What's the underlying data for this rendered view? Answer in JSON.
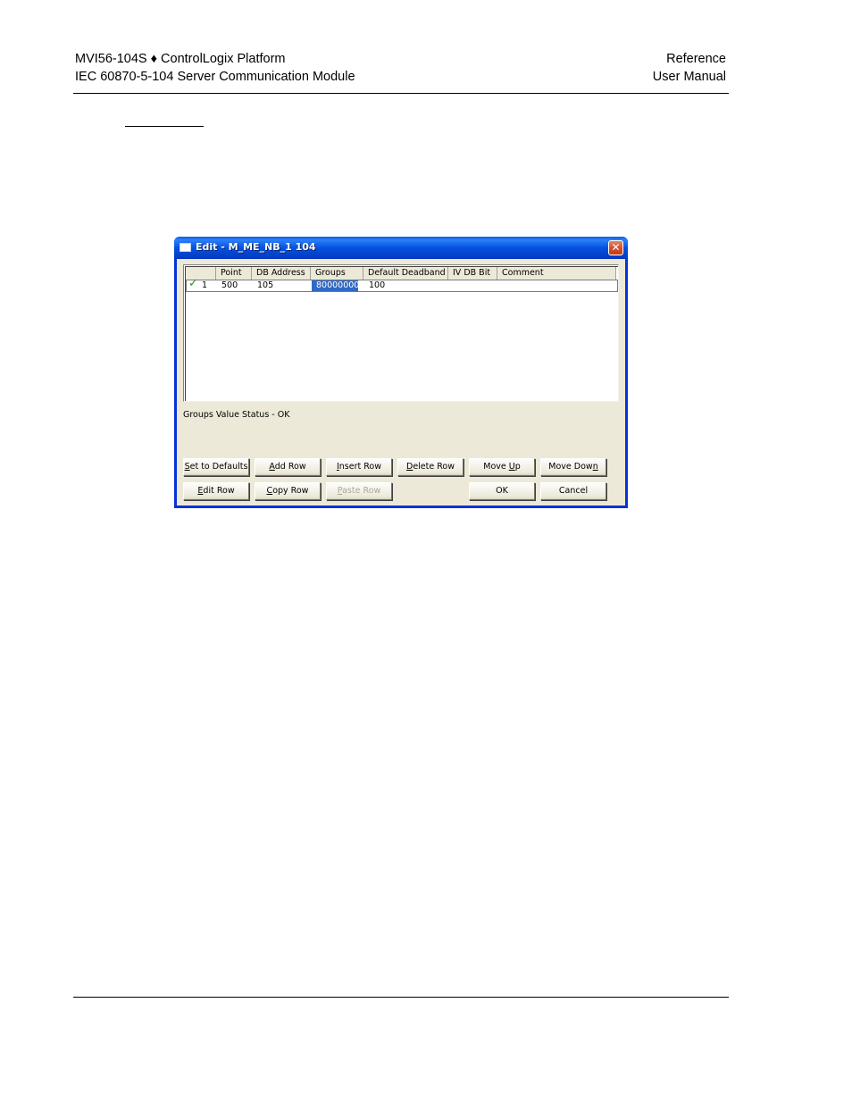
{
  "header": {
    "left_line1": "MVI56-104S ♦ ControlLogix Platform",
    "left_line2": "IEC 60870-5-104 Server Communication Module",
    "right_line1": "Reference",
    "right_line2": "User Manual"
  },
  "dialog": {
    "title": "Edit - M_ME_NB_1 104",
    "close_glyph": "✕",
    "columns": [
      "",
      "Point",
      "DB Address",
      "Groups",
      "Default Deadband",
      "IV DB Bit",
      "Comment"
    ],
    "rows": [
      {
        "status_icon": "check-icon",
        "status_glyph": "✓",
        "index": "1",
        "point": "500",
        "db_address": "105",
        "groups": "80000000",
        "default_deadband": "100",
        "iv_db_bit": "",
        "comment": ""
      }
    ],
    "selected_cell": "groups",
    "status_text": "Groups Value Status - OK",
    "buttons": {
      "set_to_defaults": {
        "pre": "",
        "u": "S",
        "post": "et to Defaults",
        "enabled": true
      },
      "add_row": {
        "pre": "",
        "u": "A",
        "post": "dd Row",
        "enabled": true
      },
      "insert_row": {
        "pre": "",
        "u": "I",
        "post": "nsert Row",
        "enabled": true
      },
      "delete_row": {
        "pre": "",
        "u": "D",
        "post": "elete Row",
        "enabled": true
      },
      "move_up": {
        "pre": "Move ",
        "u": "U",
        "post": "p",
        "enabled": true
      },
      "move_down": {
        "pre": "Move Dow",
        "u": "n",
        "post": "",
        "enabled": true
      },
      "edit_row": {
        "pre": "",
        "u": "E",
        "post": "dit Row",
        "enabled": true
      },
      "copy_row": {
        "pre": "",
        "u": "C",
        "post": "opy Row",
        "enabled": true
      },
      "paste_row": {
        "pre": "",
        "u": "P",
        "post": "aste Row",
        "enabled": false
      },
      "ok": {
        "pre": "OK",
        "u": "",
        "post": "",
        "enabled": true
      },
      "cancel": {
        "pre": "Cancel",
        "u": "",
        "post": "",
        "enabled": true
      }
    }
  },
  "colors": {
    "titlebar": "#0552e0",
    "selection": "#316ac5",
    "dialog_face": "#ece9d8",
    "check": "#1a9a1a"
  }
}
